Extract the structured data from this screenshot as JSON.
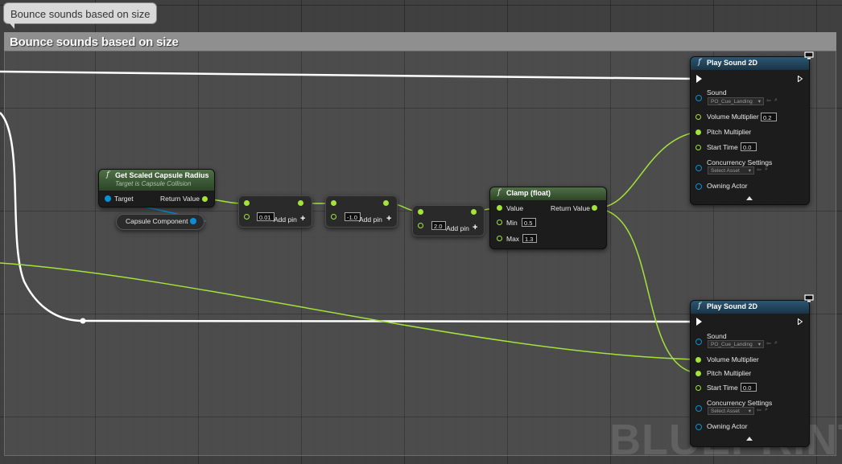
{
  "comment": {
    "bubble_text": "Bounce sounds based on size",
    "header_title": "Bounce sounds based on size"
  },
  "watermark": "BLUEPRINT",
  "nodes": {
    "get_scaled_capsule_radius": {
      "title": "Get Scaled Capsule Radius",
      "subtitle": "Target is Capsule Collision",
      "target_label": "Target",
      "return_label": "Return Value"
    },
    "capsule_component": {
      "label": "Capsule Component"
    },
    "multiply": {
      "value": "0.01",
      "add_pin": "Add pin"
    },
    "add": {
      "value": "-1.0",
      "add_pin": "Add pin"
    },
    "power": {
      "value": "2.0",
      "add_pin": "Add pin"
    },
    "clamp": {
      "title": "Clamp (float)",
      "value_label": "Value",
      "return_label": "Return Value",
      "min_label": "Min",
      "min_value": "0.5",
      "max_label": "Max",
      "max_value": "1.3"
    },
    "play_sound_top": {
      "title": "Play Sound 2D",
      "sound_label": "Sound",
      "sound_asset": "PO_Cue_Landing",
      "volume_label": "Volume Multiplier",
      "volume_value": "0.2",
      "pitch_label": "Pitch Multiplier",
      "start_label": "Start Time",
      "start_value": "0.0",
      "concurrency_label": "Concurrency Settings",
      "concurrency_asset": "Select Asset",
      "owning_label": "Owning Actor"
    },
    "play_sound_bottom": {
      "title": "Play Sound 2D",
      "sound_label": "Sound",
      "sound_asset": "PO_Cue_Landing",
      "volume_label": "Volume Multiplier",
      "pitch_label": "Pitch Multiplier",
      "start_label": "Start Time",
      "start_value": "0.0",
      "concurrency_label": "Concurrency Settings",
      "concurrency_asset": "Select Asset",
      "owning_label": "Owning Actor"
    }
  },
  "colors": {
    "exec_wire": "#ffffff",
    "float_wire": "#a3e33a",
    "object_wire": "#0a8fd6",
    "function_header": "#1d3a4e",
    "pure_header": "#3e5e36"
  },
  "icons": [
    "function-icon",
    "plus-icon",
    "monitor-icon",
    "expand-arrow-icon",
    "dropdown-arrow-icon",
    "use-asset-icon",
    "browse-icon",
    "reroute-knot"
  ]
}
